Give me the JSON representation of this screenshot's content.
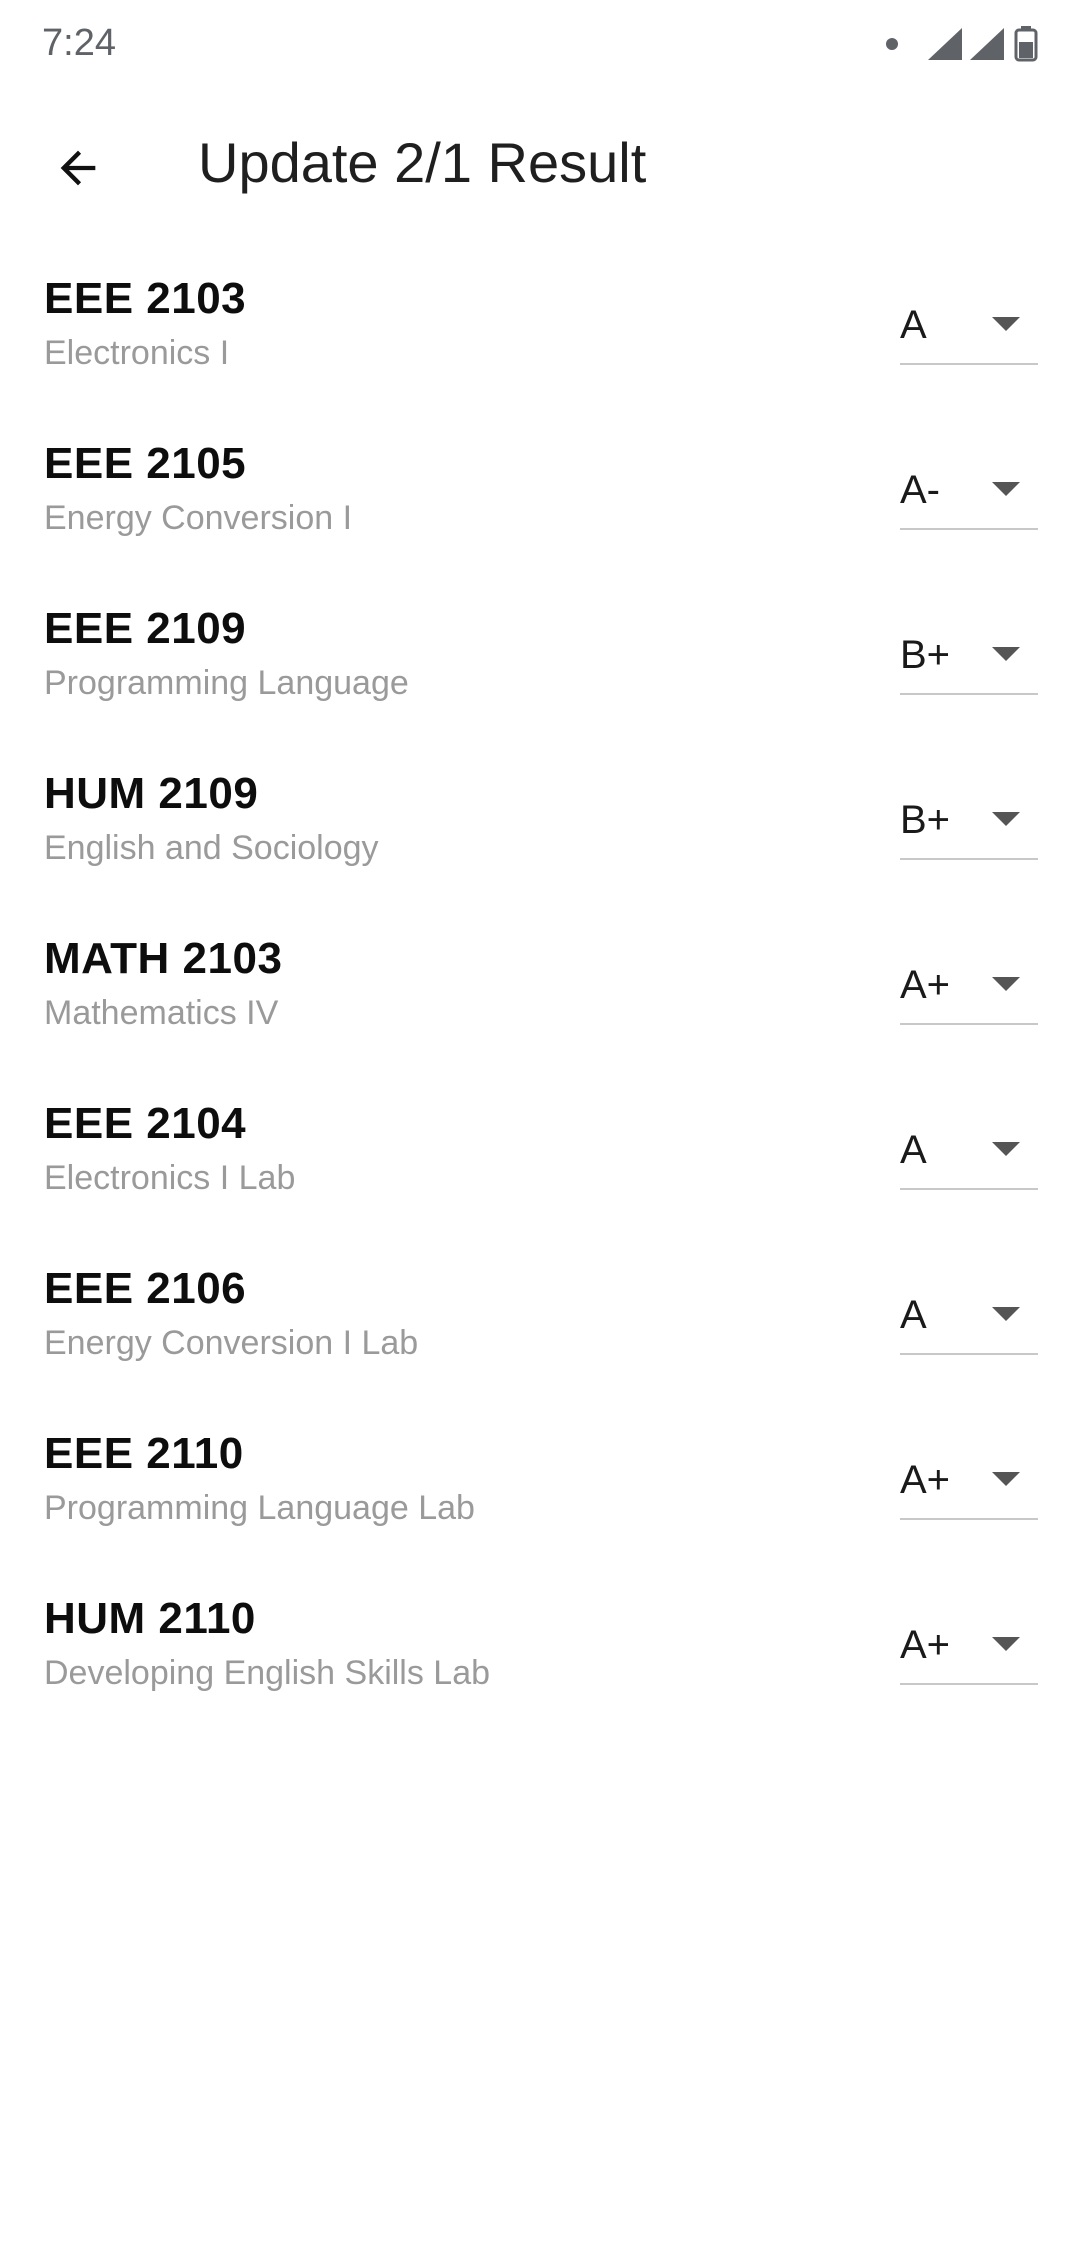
{
  "status_bar": {
    "time": "7:24",
    "icons": [
      "notification-dot-icon",
      "signal-icon",
      "signal-icon",
      "battery-icon"
    ]
  },
  "app_bar": {
    "back_icon": "arrow-back-icon",
    "title": "Update 2/1 Result"
  },
  "courses": [
    {
      "code": "EEE 2103",
      "name": "Electronics I",
      "grade": "A"
    },
    {
      "code": "EEE 2105",
      "name": "Energy Conversion I",
      "grade": "A-"
    },
    {
      "code": "EEE 2109",
      "name": "Programming Language",
      "grade": "B+"
    },
    {
      "code": "HUM 2109",
      "name": "English and Sociology",
      "grade": "B+"
    },
    {
      "code": "MATH 2103",
      "name": "Mathematics IV",
      "grade": "A+"
    },
    {
      "code": "EEE 2104",
      "name": "Electronics I Lab",
      "grade": "A"
    },
    {
      "code": "EEE 2106",
      "name": "Energy Conversion I Lab",
      "grade": "A"
    },
    {
      "code": "EEE 2110",
      "name": "Programming Language Lab",
      "grade": "A+"
    },
    {
      "code": "HUM 2110",
      "name": "Developing English Skills Lab",
      "grade": "A+"
    }
  ],
  "colors": {
    "background": "#ffffff",
    "code_text": "#0d0d0d",
    "name_text": "#9a9a9a",
    "underline": "#c8c8c8"
  }
}
